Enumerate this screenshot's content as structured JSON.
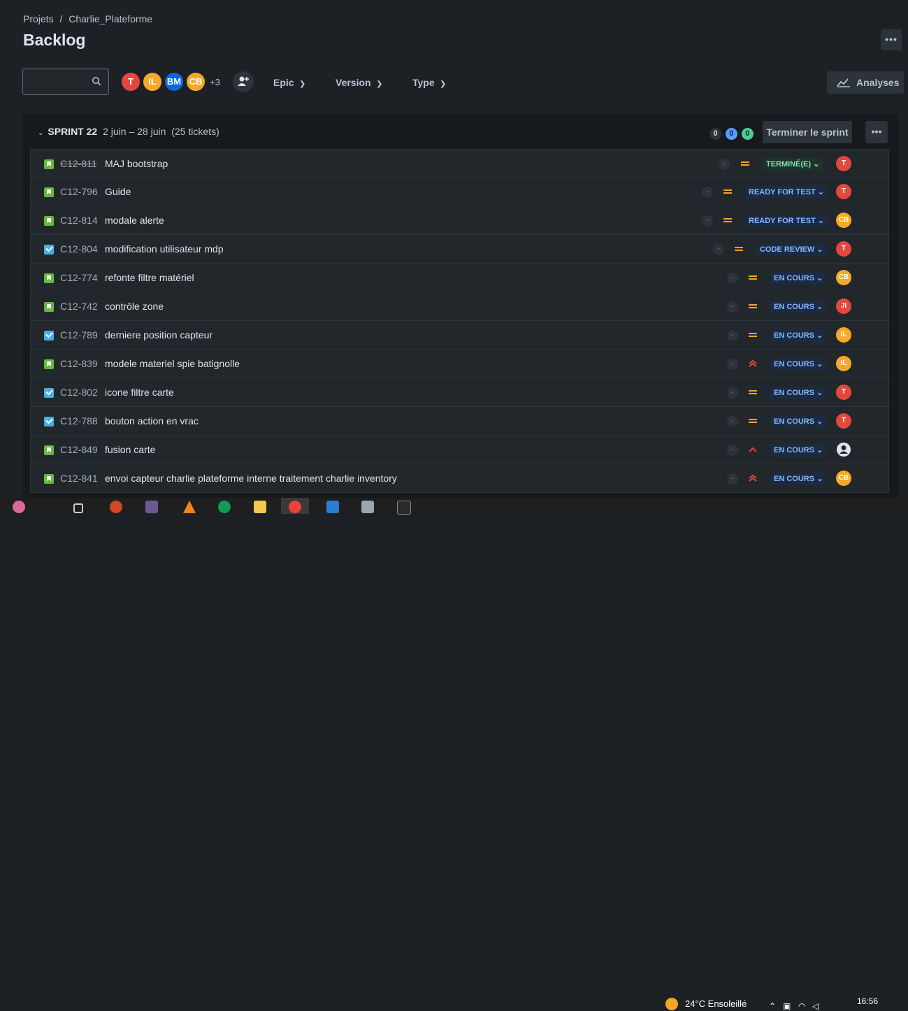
{
  "breadcrumb": {
    "root": "Projets",
    "sep": "/",
    "project": "Charlie_Plateforme"
  },
  "page": {
    "title": "Backlog"
  },
  "toolbar": {
    "avatars": [
      {
        "initials": "T",
        "color": "#e2483d"
      },
      {
        "initials": "IL",
        "color": "#f6a829"
      },
      {
        "initials": "BM",
        "color": "#0c66e4"
      },
      {
        "initials": "CB",
        "color": "#f6a829"
      }
    ],
    "more_count": "+3",
    "epic_label": "Epic",
    "version_label": "Version",
    "type_label": "Type",
    "analyses_label": "Analyses"
  },
  "sprint": {
    "name": "SPRINT 22",
    "dates": "2 juin – 28 juin",
    "tickets": "(25 tickets)",
    "count_todo": "0",
    "count_inprogress": "0",
    "count_done": "0",
    "end_label": "Terminer le sprint"
  },
  "issues": [
    {
      "type": "story",
      "key": "C12-811",
      "done": true,
      "summary": "MAJ bootstrap",
      "estimate": "-",
      "priority": "medium",
      "status": "TERMINÉ(E)",
      "status_kind": "done",
      "assignee": "T",
      "assignee_color": "#e2483d"
    },
    {
      "type": "story",
      "key": "C12-796",
      "done": false,
      "summary": "Guide",
      "estimate": "-",
      "priority": "medium",
      "status": "READY FOR TEST",
      "status_kind": "prog",
      "assignee": "T",
      "assignee_color": "#e2483d"
    },
    {
      "type": "story",
      "key": "C12-814",
      "done": false,
      "summary": "modale alerte",
      "estimate": "-",
      "priority": "medium",
      "status": "READY FOR TEST",
      "status_kind": "prog",
      "assignee": "CB",
      "assignee_color": "#f6a829"
    },
    {
      "type": "task",
      "key": "C12-804",
      "done": false,
      "summary": "modification utilisateur mdp",
      "estimate": "-",
      "priority": "medium",
      "status": "CODE REVIEW",
      "status_kind": "prog",
      "assignee": "T",
      "assignee_color": "#e2483d"
    },
    {
      "type": "story",
      "key": "C12-774",
      "done": false,
      "summary": "refonte filtre matériel",
      "estimate": "-",
      "priority": "medium",
      "status": "EN COURS",
      "status_kind": "prog",
      "assignee": "CB",
      "assignee_color": "#f6a829"
    },
    {
      "type": "story",
      "key": "C12-742",
      "done": false,
      "summary": "contrôle zone",
      "estimate": "-",
      "priority": "medium",
      "status": "EN COURS",
      "status_kind": "prog",
      "assignee": "JI",
      "assignee_color": "#e2483d"
    },
    {
      "type": "task",
      "key": "C12-789",
      "done": false,
      "summary": "derniere position capteur",
      "estimate": "-",
      "priority": "medium",
      "status": "EN COURS",
      "status_kind": "prog",
      "assignee": "IL",
      "assignee_color": "#f6a829"
    },
    {
      "type": "story",
      "key": "C12-839",
      "done": false,
      "summary": "modele materiel spie batignolle",
      "estimate": "-",
      "priority": "highest",
      "status": "EN COURS",
      "status_kind": "prog",
      "assignee": "IL",
      "assignee_color": "#f6a829"
    },
    {
      "type": "task",
      "key": "C12-802",
      "done": false,
      "summary": "icone filtre carte",
      "estimate": "-",
      "priority": "medium",
      "status": "EN COURS",
      "status_kind": "prog",
      "assignee": "T",
      "assignee_color": "#e2483d"
    },
    {
      "type": "task",
      "key": "C12-788",
      "done": false,
      "summary": "bouton action en vrac",
      "estimate": "-",
      "priority": "medium",
      "status": "EN COURS",
      "status_kind": "prog",
      "assignee": "T",
      "assignee_color": "#e2483d"
    },
    {
      "type": "story",
      "key": "C12-849",
      "done": false,
      "summary": "fusion carte",
      "estimate": "-",
      "priority": "high",
      "status": "EN COURS",
      "status_kind": "prog",
      "assignee": "",
      "assignee_color": "#dee4ea"
    },
    {
      "type": "story",
      "key": "C12-841",
      "done": false,
      "summary": "envoi capteur charlie plateforme interne traitement charlie inventory",
      "estimate": "-",
      "priority": "highest",
      "status": "EN COURS",
      "status_kind": "prog",
      "assignee": "CB",
      "assignee_color": "#f6a829"
    }
  ],
  "taskbar": {
    "weather": "24°C Ensoleillé",
    "time": "16:56"
  }
}
